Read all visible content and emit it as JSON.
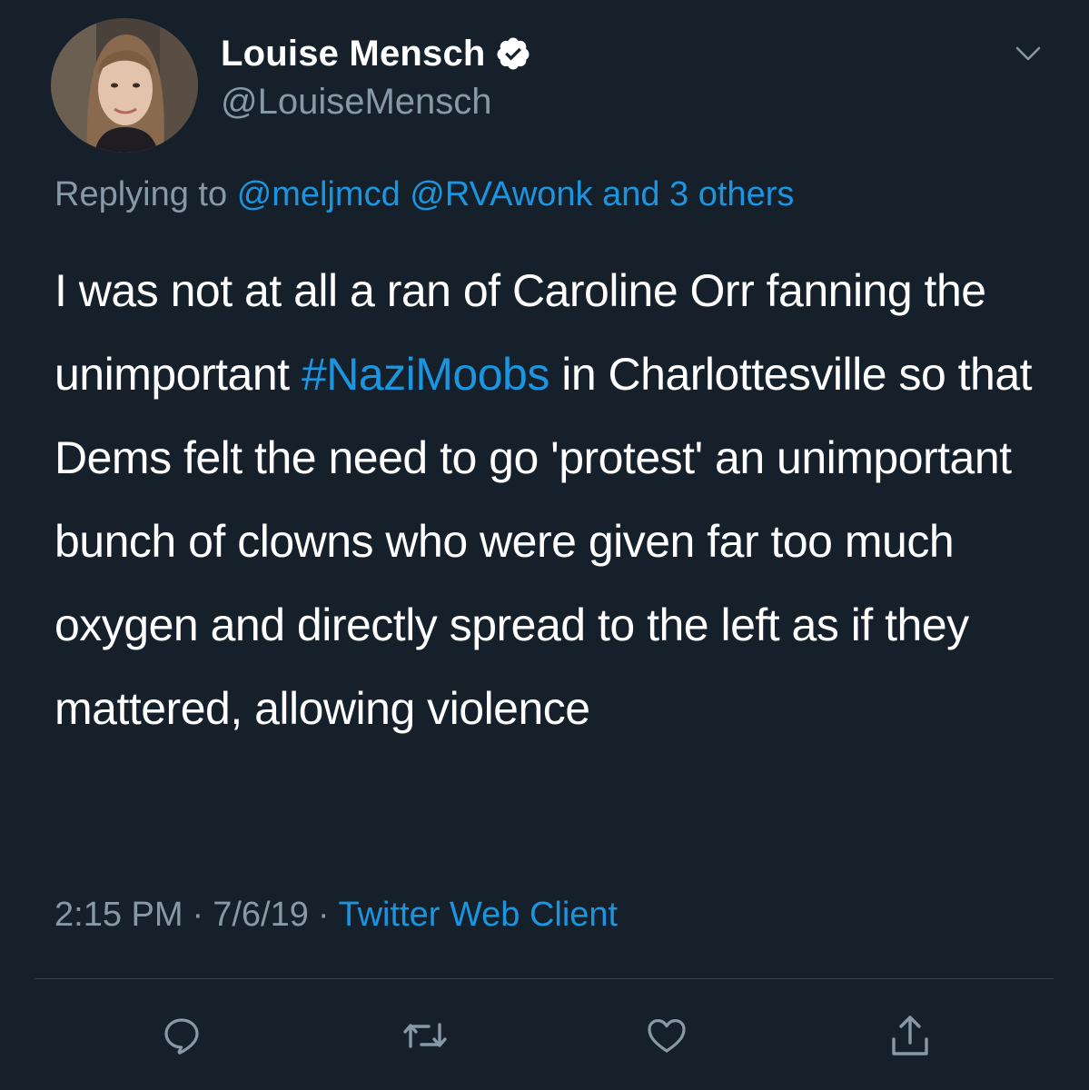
{
  "user": {
    "display_name": "Louise Mensch",
    "handle": "@LouiseMensch",
    "verified": true
  },
  "reply": {
    "prefix": "Replying to",
    "mentions": [
      "@meljmcd",
      "@RVAwonk"
    ],
    "others": "and 3 others"
  },
  "tweet": {
    "text_before": "I was not at all a ran of Caroline Orr fanning the unimportant ",
    "hashtag": "#NaziMoobs",
    "text_after": " in Charlottesville so that Dems felt the need to go 'protest' an unimportant bunch of clowns who were given far too much oxygen and directly spread to the left as if they mattered, allowing violence"
  },
  "meta": {
    "time": "2:15 PM",
    "separator": "·",
    "date": "7/6/19",
    "source": "Twitter Web Client"
  },
  "icons": {
    "caret": "chevron-down-icon",
    "verified": "verified-badge-icon",
    "reply": "reply-icon",
    "retweet": "retweet-icon",
    "like": "heart-icon",
    "share": "share-icon"
  },
  "colors": {
    "background": "#15202b",
    "text": "#ffffff",
    "secondary": "#8899a6",
    "link": "#1b95e0",
    "divider": "#38444d"
  }
}
